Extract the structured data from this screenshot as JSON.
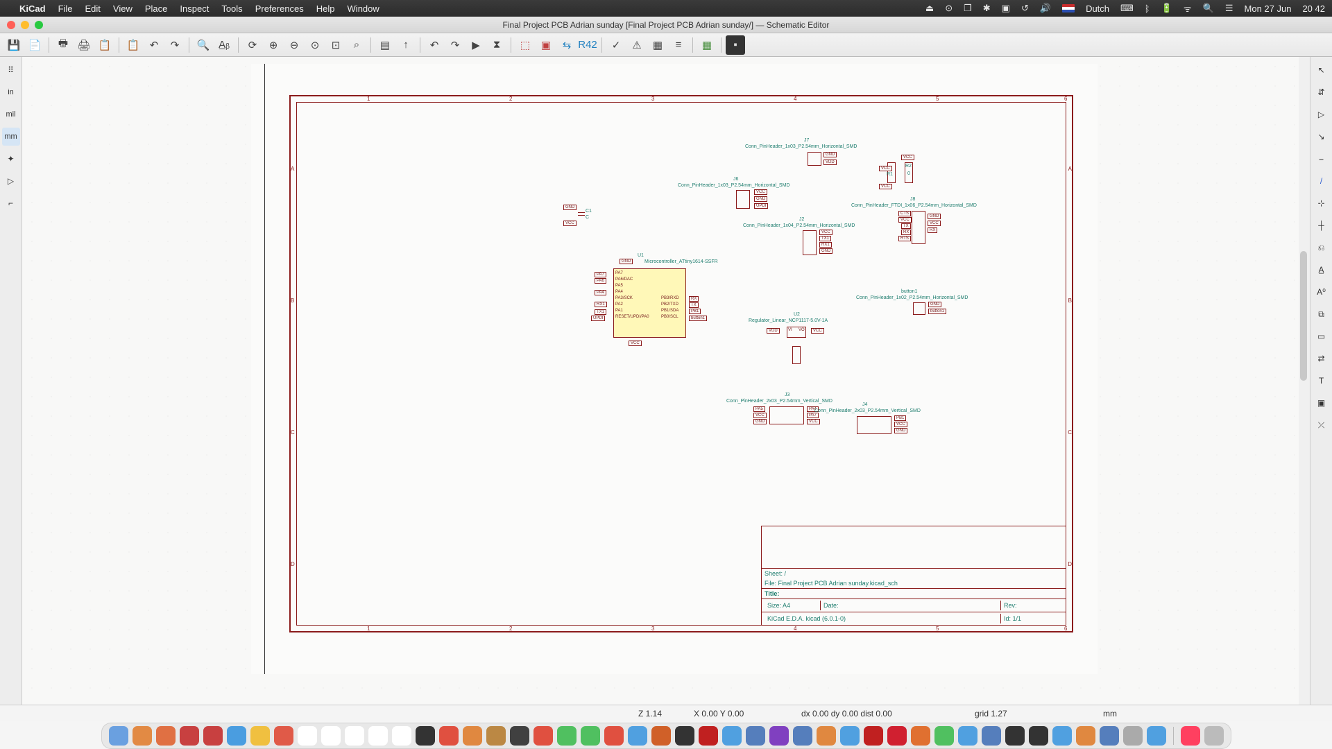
{
  "menubar": {
    "app": "KiCad",
    "menus": [
      "File",
      "Edit",
      "View",
      "Place",
      "Inspect",
      "Tools",
      "Preferences",
      "Help",
      "Window"
    ],
    "lang": "Dutch",
    "date": "Mon 27 Jun",
    "time": "20 42"
  },
  "window": {
    "title": "Final Project PCB Adrian sunday [Final Project PCB Adrian sunday/] — Schematic Editor"
  },
  "left_palette": [
    "⠿",
    "in",
    "mil",
    "mm",
    "✦",
    "▷",
    "⌐"
  ],
  "right_palette": [
    "↖",
    "⇵",
    "▷",
    "↘",
    "⎯",
    "/",
    "⊹",
    "┼",
    "⎌",
    "A̲",
    "A⁰",
    "⧉",
    "▭",
    "⇄",
    "T",
    "▣",
    "⤫"
  ],
  "titleblock": {
    "sheet": "Sheet: /",
    "file": "File: Final Project PCB Adrian sunday.kicad_sch",
    "title": "Title:",
    "size": "Size: A4",
    "date": "Date:",
    "rev": "Rev:",
    "gen": "KiCad E.D.A.  kicad (6.0.1-0)",
    "id": "Id: 1/1"
  },
  "nets": [
    "VCC",
    "GND",
    "VDD",
    "UPDI",
    "TX1",
    "RX1",
    "TX",
    "RX",
    "CTS",
    "RTS",
    "PA6",
    "PA5",
    "PA4",
    "PA7",
    "PB1",
    "button1"
  ],
  "components": {
    "J7": {
      "ref": "J7",
      "name": "Conn_PinHeader_1x03_P2.54mm_Horizontal_SMD"
    },
    "J6": {
      "ref": "J6",
      "name": "Conn_PinHeader_1x03_P2.54mm_Horizontal_SMD"
    },
    "J2": {
      "ref": "J2",
      "name": "Conn_PinHeader_1x04_P2.54mm_Horizontal_SMD"
    },
    "J8": {
      "ref": "J8",
      "name": "Conn_PinHeader_FTDI_1x06_P2.54mm_Horizontal_SMD"
    },
    "J3": {
      "ref": "J3",
      "name": "Conn_PinHeader_2x03_P2.54mm_Vertical_SMD"
    },
    "J4": {
      "ref": "J4",
      "name": "Conn_PinHeader_2x03_P2.54mm_Vertical_SMD"
    },
    "U1": {
      "ref": "U1",
      "name": "Microcontroller_ATtiny1614-SSFR"
    },
    "U2": {
      "ref": "U2",
      "name": "Regulator_Linear_NCP1117-5.0V-1A"
    },
    "R2": {
      "ref": "R2",
      "name": "0"
    },
    "R1": {
      "ref": "R1"
    },
    "C1": {
      "ref": "C1",
      "name": "C"
    },
    "button1": {
      "ref": "button1",
      "name": "Conn_PinHeader_1x02_P2.54mm_Horizontal_SMD"
    }
  },
  "u1_pins_left": [
    "PA7",
    "PA6/DAC",
    "PA5",
    "PA4",
    "PA3/SCK",
    "PA2",
    "PA1",
    "RESET/UPDI/PA0"
  ],
  "u1_pins_right": [
    "PB3/RXD",
    "PB2/TXD",
    "PB1/SDA",
    "PB0/SCL"
  ],
  "sheet_marks_top": [
    "1",
    "2",
    "3",
    "4",
    "5",
    "6"
  ],
  "sheet_marks_side": [
    "A",
    "B",
    "C",
    "D"
  ],
  "status": {
    "z": "Z 1.14",
    "xy": "X 0.00  Y 0.00",
    "dxy": "dx 0.00  dy 0.00  dist 0.00",
    "grid": "grid 1.27",
    "unit": "mm"
  },
  "dock_colors": [
    "#6aa0e0",
    "#e28a44",
    "#e07043",
    "#c84040",
    "#c84040",
    "#4a9de0",
    "#f0c040",
    "#e05a48",
    "#fff",
    "#fff",
    "#fff",
    "#fff",
    "#fff",
    "#333",
    "#e05040",
    "#e08840",
    "#bb8844",
    "#404040",
    "#e05040",
    "#50c060",
    "#50c060",
    "#e05040",
    "#50a0e0",
    "#d06028",
    "#333",
    "#c02020",
    "#50a0e0",
    "#557ebc",
    "#8040c0",
    "#557ebc",
    "#e08840",
    "#50a0e0",
    "#c02020",
    "#d02030",
    "#e07030",
    "#50c060",
    "#50a0e0",
    "#557ebc",
    "#333",
    "#333",
    "#50a0e0",
    "#e08840",
    "#557ebc",
    "#aaa",
    "#50a0e0",
    "#ff4060",
    "#bbb"
  ]
}
